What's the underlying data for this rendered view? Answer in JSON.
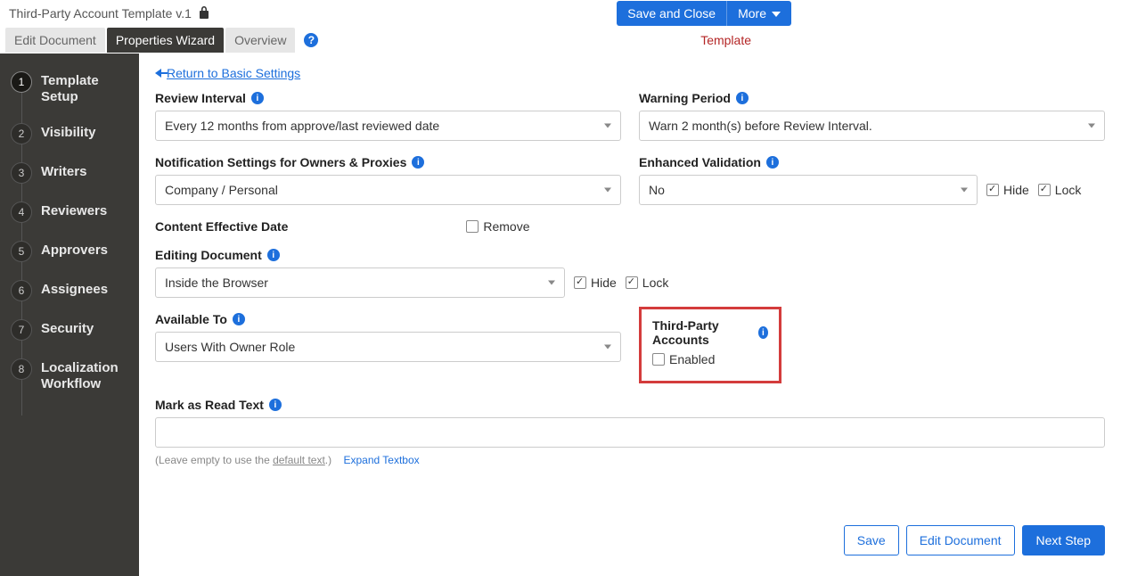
{
  "header": {
    "title": "Third-Party Account Template v.1",
    "save_close": "Save and Close",
    "more": "More"
  },
  "tabs": {
    "edit": "Edit Document",
    "wizard": "Properties Wizard",
    "overview": "Overview",
    "template_label": "Template"
  },
  "sidebar": {
    "steps": [
      "Template Setup",
      "Visibility",
      "Writers",
      "Reviewers",
      "Approvers",
      "Assignees",
      "Security",
      "Localization Workflow"
    ]
  },
  "main": {
    "back_link": "Return to Basic Settings",
    "review_interval": {
      "label": "Review Interval",
      "value": "Every 12 months from approve/last reviewed date"
    },
    "warning_period": {
      "label": "Warning Period",
      "value": "Warn 2 month(s) before Review Interval."
    },
    "notification_settings": {
      "label": "Notification Settings for Owners & Proxies",
      "value": "Company / Personal"
    },
    "enhanced_validation": {
      "label": "Enhanced Validation",
      "value": "No",
      "hide": "Hide",
      "lock": "Lock"
    },
    "content_effective_date": {
      "label": "Content Effective Date",
      "remove": "Remove"
    },
    "editing_document": {
      "label": "Editing Document",
      "value": "Inside the Browser",
      "hide": "Hide",
      "lock": "Lock"
    },
    "available_to": {
      "label": "Available To",
      "value": "Users With Owner Role"
    },
    "third_party": {
      "label": "Third-Party Accounts",
      "enabled": "Enabled"
    },
    "mark_as_read": {
      "label": "Mark as Read Text",
      "hint_prefix": "(Leave empty to use the ",
      "hint_link": "default text",
      "hint_suffix": ".)",
      "expand": "Expand Textbox"
    },
    "footer": {
      "save": "Save",
      "edit": "Edit Document",
      "next": "Next Step"
    }
  }
}
